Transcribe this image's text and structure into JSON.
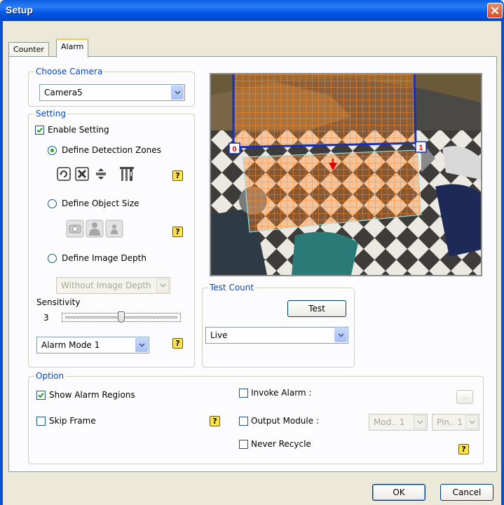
{
  "window": {
    "title": "Setup"
  },
  "tabs": [
    {
      "label": "Counter",
      "active": false
    },
    {
      "label": "Alarm",
      "active": true
    }
  ],
  "choose_camera": {
    "title": "Choose Camera",
    "selected": "Camera5"
  },
  "setting": {
    "title": "Setting",
    "enable_label": "Enable Setting",
    "enable_checked": true,
    "detection_zones_label": "Define Detection Zones",
    "object_size_label": "Define Object Size",
    "image_depth_label": "Define Image Depth",
    "image_depth_selected": "Without Image Depth",
    "sensitivity_label": "Sensitivity",
    "sensitivity_value": "3",
    "sensitivity_fraction": 0.5,
    "alarm_mode_selected": "Alarm Mode 1",
    "help_glyph": "?"
  },
  "preview": {
    "zone_labels": [
      "0",
      "1"
    ]
  },
  "test_count": {
    "title": "Test Count",
    "test_button": "Test",
    "mode_selected": "Live"
  },
  "option": {
    "title": "Option",
    "show_alarm_regions": "Show Alarm Regions",
    "show_alarm_regions_checked": true,
    "skip_frame": "Skip Frame",
    "invoke_alarm": "Invoke Alarm :",
    "browse_button": "...",
    "output_module": "Output Module :",
    "module_selected": "Mod.. 1",
    "pin_selected": "Pin.. 1",
    "never_recycle": "Never Recycle"
  },
  "buttons": {
    "ok": "OK",
    "cancel": "Cancel"
  },
  "colors": {
    "titlebar": "#0058e6",
    "groupbox_title": "#0046d5",
    "help_icon": "#ffe34d",
    "grid": "#ff8a2a",
    "zone_line": "#1a2fb8",
    "close_button": "#d34a24"
  }
}
